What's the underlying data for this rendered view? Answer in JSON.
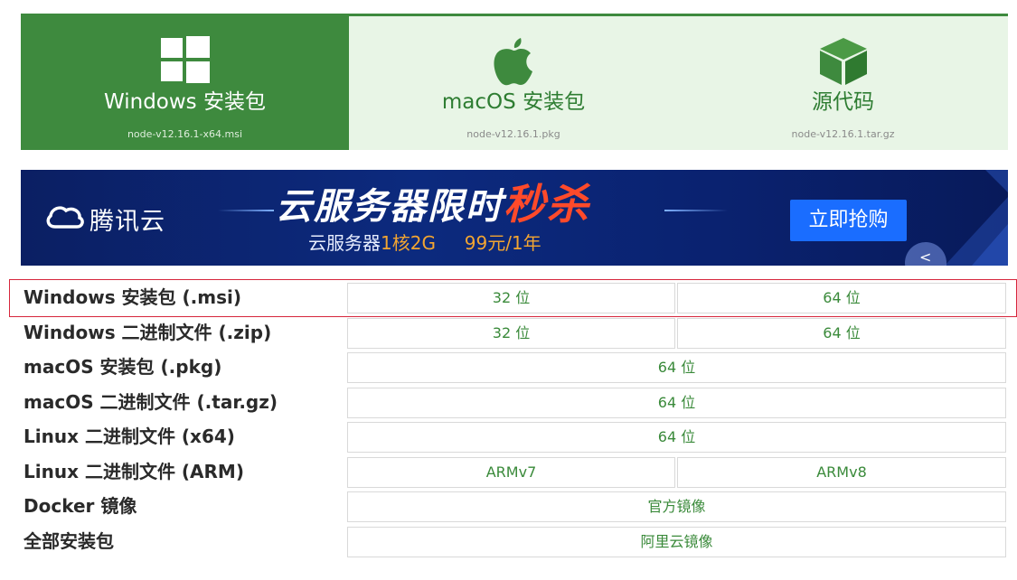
{
  "tabs": [
    {
      "title": "Windows 安装包",
      "file": "node-v12.16.1-x64.msi",
      "icon": "windows-icon",
      "active": true
    },
    {
      "title": "macOS 安装包",
      "file": "node-v12.16.1.pkg",
      "icon": "apple-icon",
      "active": false
    },
    {
      "title": "源代码",
      "file": "node-v12.16.1.tar.gz",
      "icon": "cube-icon",
      "active": false
    }
  ],
  "banner": {
    "brand": "腾讯云",
    "headline_main": "云服务器限时",
    "headline_hot": "秒杀",
    "sub_prefix": "云服务器",
    "sub_highlight": "1核2G",
    "sub_price": "99元/1年",
    "cta": "立即抢购"
  },
  "downloads": [
    {
      "label": "Windows 安装包 (.msi)",
      "cells": [
        "32 位",
        "64 位"
      ]
    },
    {
      "label": "Windows 二进制文件 (.zip)",
      "cells": [
        "32 位",
        "64 位"
      ]
    },
    {
      "label": "macOS 安装包 (.pkg)",
      "cells": [
        "64 位"
      ]
    },
    {
      "label": "macOS 二进制文件 (.tar.gz)",
      "cells": [
        "64 位"
      ]
    },
    {
      "label": "Linux 二进制文件 (x64)",
      "cells": [
        "64 位"
      ]
    },
    {
      "label": "Linux 二进制文件 (ARM)",
      "cells": [
        "ARMv7",
        "ARMv8"
      ]
    },
    {
      "label": "Docker 镜像",
      "cells": [
        "官方镜像"
      ]
    },
    {
      "label": "全部安装包",
      "cells": [
        "阿里云镜像"
      ]
    }
  ],
  "colors": {
    "accent": "#3e8a3e",
    "tab_inactive_bg": "#e8f5e6",
    "link_green": "#3a8a3a",
    "highlight": "#d6263c",
    "banner_bg": "#0c2a7e",
    "cta_blue": "#1a6dff"
  }
}
